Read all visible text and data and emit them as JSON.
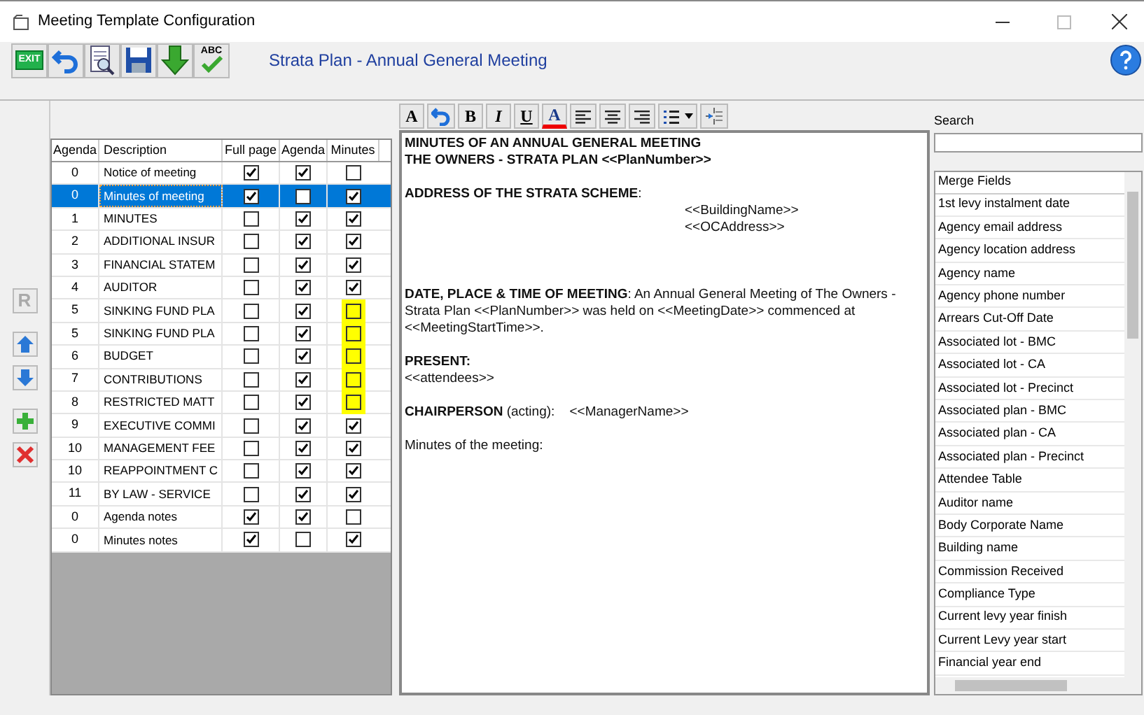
{
  "window": {
    "title": "Meeting Template Configuration"
  },
  "header": {
    "title": "Strata Plan - Annual General Meeting"
  },
  "toolbar": [
    {
      "kind": "exit",
      "label": "EXIT"
    },
    {
      "kind": "undo"
    },
    {
      "kind": "preview"
    },
    {
      "kind": "save"
    },
    {
      "kind": "import"
    },
    {
      "kind": "spell",
      "label": "ABC"
    }
  ],
  "side_buttons": [
    {
      "kind": "reset",
      "label": "R",
      "disabled": true
    },
    {
      "kind": "up",
      "disabled": false
    },
    {
      "kind": "down",
      "disabled": false
    },
    {
      "kind": "add",
      "disabled": false
    },
    {
      "kind": "delete",
      "disabled": false
    }
  ],
  "table": {
    "columns": [
      "Agenda",
      "Description",
      "Full page",
      "Agenda",
      "Minutes"
    ],
    "rows": [
      {
        "agenda": "0",
        "description": "Notice of meeting",
        "selected": false,
        "full_page": true,
        "in_agenda": true,
        "in_minutes": false,
        "highlighted": false
      },
      {
        "agenda": "0",
        "description": "Minutes of meeting",
        "selected": true,
        "full_page": true,
        "in_agenda": false,
        "in_minutes": true,
        "highlighted": false
      },
      {
        "agenda": "1",
        "description": "MINUTES",
        "selected": false,
        "full_page": false,
        "in_agenda": true,
        "in_minutes": true,
        "highlighted": false
      },
      {
        "agenda": "2",
        "description": "ADDITIONAL INSUR",
        "selected": false,
        "full_page": false,
        "in_agenda": true,
        "in_minutes": true,
        "highlighted": false
      },
      {
        "agenda": "3",
        "description": "FINANCIAL STATEM",
        "selected": false,
        "full_page": false,
        "in_agenda": true,
        "in_minutes": true,
        "highlighted": false
      },
      {
        "agenda": "4",
        "description": "AUDITOR",
        "selected": false,
        "full_page": false,
        "in_agenda": true,
        "in_minutes": true,
        "highlighted": false
      },
      {
        "agenda": "5",
        "description": "SINKING FUND PLA",
        "selected": false,
        "full_page": false,
        "in_agenda": true,
        "in_minutes": false,
        "highlighted": true
      },
      {
        "agenda": "5",
        "description": "SINKING FUND PLA",
        "selected": false,
        "full_page": false,
        "in_agenda": true,
        "in_minutes": false,
        "highlighted": true
      },
      {
        "agenda": "6",
        "description": "BUDGET",
        "selected": false,
        "full_page": false,
        "in_agenda": true,
        "in_minutes": false,
        "highlighted": true
      },
      {
        "agenda": "7",
        "description": "CONTRIBUTIONS",
        "selected": false,
        "full_page": false,
        "in_agenda": true,
        "in_minutes": false,
        "highlighted": true
      },
      {
        "agenda": "8",
        "description": "RESTRICTED MATT",
        "selected": false,
        "full_page": false,
        "in_agenda": true,
        "in_minutes": false,
        "highlighted": true
      },
      {
        "agenda": "9",
        "description": "EXECUTIVE COMMI",
        "selected": false,
        "full_page": false,
        "in_agenda": true,
        "in_minutes": true,
        "highlighted": false
      },
      {
        "agenda": "10",
        "description": "MANAGEMENT FEE",
        "selected": false,
        "full_page": false,
        "in_agenda": true,
        "in_minutes": true,
        "highlighted": false
      },
      {
        "agenda": "10",
        "description": "REAPPOINTMENT C",
        "selected": false,
        "full_page": false,
        "in_agenda": true,
        "in_minutes": true,
        "highlighted": false
      },
      {
        "agenda": "11",
        "description": "BY LAW - SERVICE",
        "selected": false,
        "full_page": false,
        "in_agenda": true,
        "in_minutes": true,
        "highlighted": false
      },
      {
        "agenda": "0",
        "description": "Agenda notes",
        "selected": false,
        "full_page": true,
        "in_agenda": true,
        "in_minutes": false,
        "highlighted": false
      },
      {
        "agenda": "0",
        "description": "Minutes notes",
        "selected": false,
        "full_page": true,
        "in_agenda": false,
        "in_minutes": true,
        "highlighted": false
      }
    ]
  },
  "editor_toolbar": [
    {
      "kind": "font",
      "label": "A"
    },
    {
      "kind": "undo"
    },
    {
      "kind": "bold",
      "label": "B"
    },
    {
      "kind": "italic",
      "label": "I"
    },
    {
      "kind": "underline",
      "label": "U"
    },
    {
      "kind": "color",
      "label": "A"
    },
    {
      "kind": "align-left"
    },
    {
      "kind": "align-center"
    },
    {
      "kind": "align-right"
    },
    {
      "kind": "list"
    },
    {
      "kind": "page-break"
    }
  ],
  "document": [
    {
      "kind": "text",
      "text": "**MINUTES OF AN ANNUAL GENERAL MEETING**"
    },
    {
      "kind": "text",
      "text": "**THE OWNERS - STRATA PLAN <<PlanNumber>>**"
    },
    {
      "kind": "blank"
    },
    {
      "kind": "text",
      "text": "**ADDRESS OF THE STRATA SCHEME**:"
    },
    {
      "kind": "indented",
      "text": "<<BuildingName>>"
    },
    {
      "kind": "indented",
      "text": "<<OCAddress>>"
    },
    {
      "kind": "blank"
    },
    {
      "kind": "blank"
    },
    {
      "kind": "blank"
    },
    {
      "kind": "text",
      "text": "**DATE, PLACE & TIME OF MEETING**: An Annual General Meeting of The Owners - Strata Plan <<PlanNumber>> was held on <<MeetingDate>> commenced at <<MeetingStartTime>>."
    },
    {
      "kind": "blank"
    },
    {
      "kind": "text",
      "text": "**PRESENT:**"
    },
    {
      "kind": "text",
      "text": "<<attendees>>"
    },
    {
      "kind": "blank"
    },
    {
      "kind": "text",
      "text": "**CHAIRPERSON** (acting):    <<ManagerName>>"
    },
    {
      "kind": "blank"
    },
    {
      "kind": "text",
      "text": "Minutes of the meeting:"
    }
  ],
  "search": {
    "label": "Search"
  },
  "merge_fields": {
    "heading": "Merge Fields",
    "items": [
      "1st levy instalment date",
      "Agency email address",
      "Agency location address",
      "Agency name",
      "Agency phone number",
      "Arrears Cut-Off Date",
      "Associated lot - BMC",
      "Associated lot - CA",
      "Associated lot - Precinct",
      "Associated plan - BMC",
      "Associated plan - CA",
      "Associated plan - Precinct",
      "Attendee Table",
      "Auditor name",
      "Body Corporate Name",
      "Building name",
      "Commission Received",
      "Compliance Type",
      "Current levy year finish",
      "Current Levy year start",
      "Financial year end"
    ]
  }
}
